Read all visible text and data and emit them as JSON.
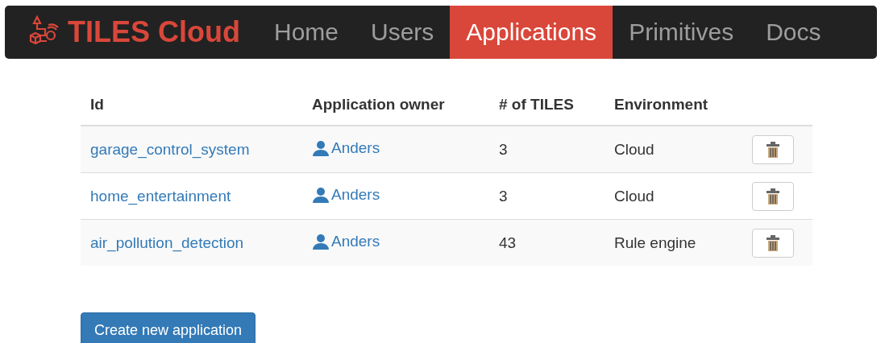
{
  "brand": "TILES Cloud",
  "nav": [
    {
      "label": "Home",
      "selected": false
    },
    {
      "label": "Users",
      "selected": false
    },
    {
      "label": "Applications",
      "selected": true
    },
    {
      "label": "Primitives",
      "selected": false
    },
    {
      "label": "Docs",
      "selected": false
    }
  ],
  "table": {
    "columns": [
      "Id",
      "Application owner",
      "# of TILES",
      "Environment"
    ],
    "rows": [
      {
        "id": "garage_control_system",
        "owner": "Anders",
        "tiles": "3",
        "environment": "Cloud"
      },
      {
        "id": "home_entertainment",
        "owner": "Anders",
        "tiles": "3",
        "environment": "Cloud"
      },
      {
        "id": "air_pollution_detection",
        "owner": "Anders",
        "tiles": "43",
        "environment": "Rule engine"
      }
    ]
  },
  "create_button": "Create new application"
}
